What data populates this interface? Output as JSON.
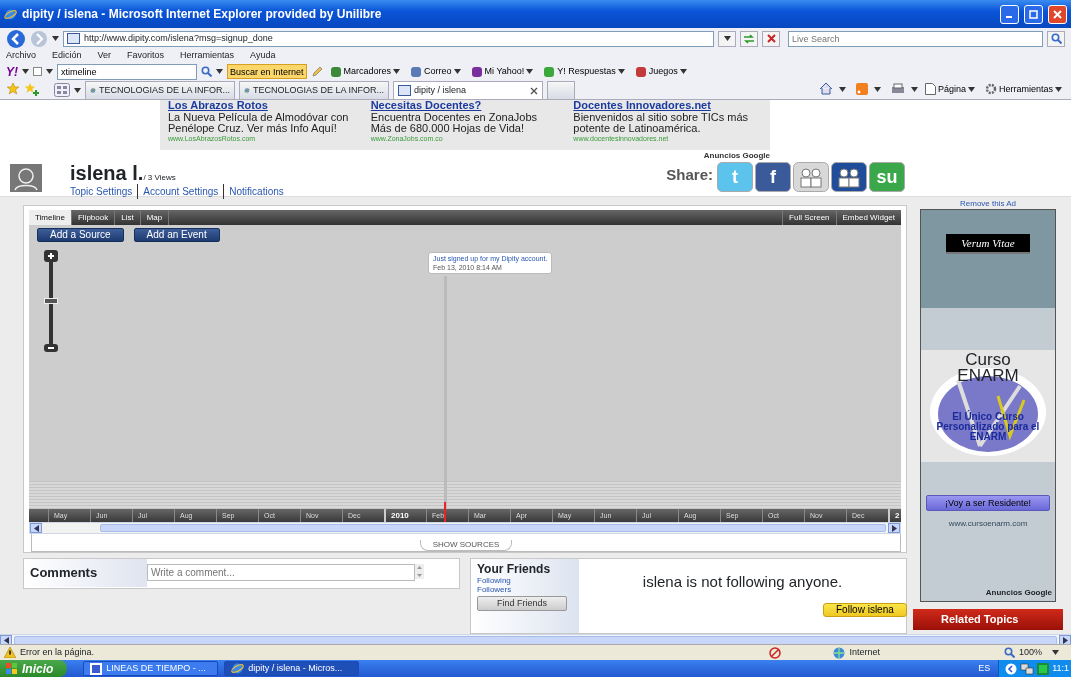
{
  "window": {
    "title": "dipity / islena - Microsoft Internet Explorer provided by Unilibre"
  },
  "address_bar": {
    "url": "http://www.dipity.com/islena?msg=signup_done",
    "search_placeholder": "Live Search"
  },
  "menu": [
    "Archivo",
    "Edición",
    "Ver",
    "Favoritos",
    "Herramientas",
    "Ayuda"
  ],
  "yahoo_toolbar": {
    "logo": "Y!",
    "search_value": "xtimeline",
    "search_button": "Buscar en Internet",
    "items": [
      {
        "label": "Marcadores",
        "color": "#3a8a3a"
      },
      {
        "label": "Correo",
        "color": "#5a7ab8"
      },
      {
        "label": "Mi Yahoo!",
        "color": "#7b2e9e"
      },
      {
        "label": "Y! Respuestas",
        "color": "#3aa83a"
      },
      {
        "label": "Juegos",
        "color": "#c23a3a"
      }
    ]
  },
  "tabs": [
    {
      "label": "TECNOLOGIAS DE LA INFOR...",
      "selected": false
    },
    {
      "label": "TECNOLOGIAS DE LA INFOR...",
      "selected": false
    },
    {
      "label": "dipity / islena",
      "selected": true
    }
  ],
  "command_bar": [
    "Página",
    "Herramientas"
  ],
  "ads": [
    {
      "title": "Los Abrazos Rotos",
      "text": "La Nueva Película de Almodóvar con Penélope Cruz. Ver más Info Aquí!",
      "url": "www.LosAbrazosRotos.com"
    },
    {
      "title": "Necesitas Docentes?",
      "text": "Encuentra Docentes en ZonaJobs Más de 680.000 Hojas de Vida!",
      "url": "www.ZonaJobs.com.co"
    },
    {
      "title": "Docentes Innovadores.net",
      "text": "Bienvenidos al sitio sobre TICs más potente de Latinoamérica.",
      "url": "www.docentesinnovadores.net"
    }
  ],
  "ads_label": "Anuncios Google",
  "profile": {
    "name": "islena l.",
    "views": "/ 3 Views",
    "links": [
      "Topic Settings",
      "Account Settings",
      "Notifications"
    ]
  },
  "share": {
    "label": "Share:",
    "services": [
      {
        "kind": "letter",
        "glyph": "t",
        "color": "#5cc4ec"
      },
      {
        "kind": "letter",
        "glyph": "f",
        "color": "#3b5a9a"
      },
      {
        "kind": "people",
        "color": "#d8d8d8"
      },
      {
        "kind": "people",
        "color": "#1f4d9a"
      },
      {
        "kind": "letter",
        "glyph": "su",
        "color": "#3aa84a"
      }
    ]
  },
  "timeline": {
    "tabs": [
      {
        "label": "Timeline",
        "selected": true
      },
      {
        "label": "Flipbook",
        "selected": false
      },
      {
        "label": "List",
        "selected": false
      },
      {
        "label": "Map",
        "selected": false
      }
    ],
    "right_tabs": [
      "Full Screen",
      "Embed Widget"
    ],
    "buttons": [
      "Add a Source",
      "Add an Event"
    ],
    "zoom": {
      "level": 0.5
    },
    "event": {
      "text": "Just signed up for my Dipity account.",
      "date": "Feb 13, 2010 8:14 AM"
    },
    "axis": [
      {
        "label": "May",
        "kind": "month"
      },
      {
        "label": "Jun",
        "kind": "month"
      },
      {
        "label": "Jul",
        "kind": "month"
      },
      {
        "label": "Aug",
        "kind": "month"
      },
      {
        "label": "Sep",
        "kind": "month"
      },
      {
        "label": "Oct",
        "kind": "month"
      },
      {
        "label": "Nov",
        "kind": "month"
      },
      {
        "label": "Dec",
        "kind": "month"
      },
      {
        "label": "2010",
        "kind": "year"
      },
      {
        "label": "Feb",
        "kind": "month"
      },
      {
        "label": "Mar",
        "kind": "month"
      },
      {
        "label": "Apr",
        "kind": "month"
      },
      {
        "label": "May",
        "kind": "month"
      },
      {
        "label": "Jun",
        "kind": "month"
      },
      {
        "label": "Jul",
        "kind": "month"
      },
      {
        "label": "Aug",
        "kind": "month"
      },
      {
        "label": "Sep",
        "kind": "month"
      },
      {
        "label": "Oct",
        "kind": "month"
      },
      {
        "label": "Nov",
        "kind": "month"
      },
      {
        "label": "Dec",
        "kind": "month"
      },
      {
        "label": "2",
        "kind": "year"
      }
    ],
    "show_sources": "SHOW SOURCES"
  },
  "side_ad": {
    "remove": "Remove this Ad",
    "brand": "Verum Vitae",
    "title": "Curso ENARM",
    "subtitle": "El Único Curso Personalizado para el ENARM",
    "button": "¡Voy a ser Residente!",
    "url": "www.cursoenarm.com",
    "label": "Anuncios Google"
  },
  "comments": {
    "title": "Comments",
    "placeholder": "Write a comment..."
  },
  "friends": {
    "title": "Your Friends",
    "links": [
      "Following",
      "Followers"
    ],
    "button": "Find Friends",
    "message": "islena is not following anyone."
  },
  "follow_button": "Follow islena",
  "related_topics": {
    "title": "Related Topics"
  },
  "status_bar": {
    "message": "Error en la página.",
    "zone": "Internet",
    "zoom": "100%"
  },
  "taskbar": {
    "start": "Inicio",
    "tasks": [
      {
        "label": "LINEAS DE TIEMPO - ...",
        "selected": false
      },
      {
        "label": "dipity / islena - Micros...",
        "selected": true
      }
    ],
    "lang": "ES",
    "clock": "11:1"
  }
}
